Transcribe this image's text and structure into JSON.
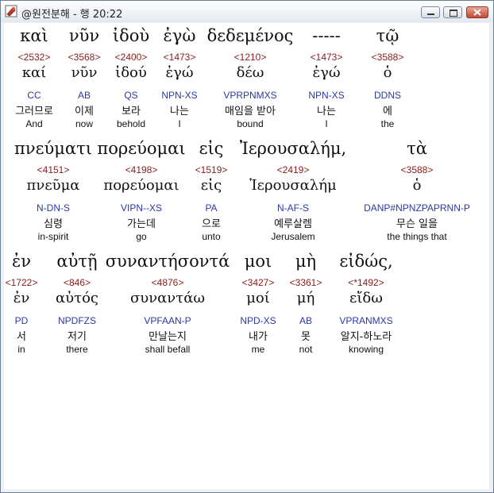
{
  "window": {
    "title": "@원전분해 - 행 20:22",
    "icon": "bible-icon",
    "buttons": [
      "minimize",
      "maximize",
      "close"
    ]
  },
  "colors": {
    "strongs": "#8b1a1a",
    "parsing": "#2a3aa0",
    "text": "#111111",
    "highlight_bg": "#ffffff"
  },
  "lines": [
    {
      "words": [
        {
          "greek": "καὶ",
          "strongs": "<2532>",
          "lemma": "καί",
          "parse": "CC",
          "korean": "그러므로",
          "english": "And"
        },
        {
          "greek": "νῦν",
          "strongs": "<3568>",
          "lemma": "νῦν",
          "parse": "AB",
          "korean": "이제",
          "english": "now"
        },
        {
          "greek": "ἰδοὺ",
          "strongs": "<2400>",
          "lemma": "ἰδού",
          "parse": "QS",
          "korean": "보라",
          "english": "behold"
        },
        {
          "greek": "ἐγὼ",
          "strongs": "<1473>",
          "lemma": "ἐγώ",
          "parse": "NPN-XS",
          "korean": "나는",
          "english": "I"
        },
        {
          "greek": "δεδεμένος",
          "strongs": "<1210>",
          "lemma": "δέω",
          "parse": "VPRPNMXS",
          "korean": "매임을 받아",
          "english": "bound"
        },
        {
          "greek": "-----",
          "strongs": "<1473>",
          "lemma": "ἐγώ",
          "parse": "NPN-XS",
          "korean": "나는",
          "english": "I"
        },
        {
          "greek": "τῷ",
          "strongs": "<3588>",
          "lemma": "ὁ",
          "parse": "DDNS",
          "korean": "에",
          "english": "the"
        }
      ]
    },
    {
      "words": [
        {
          "greek": "πνεύματι",
          "strongs": "<4151>",
          "lemma": "πνεῦμα",
          "parse": "N-DN-S",
          "korean": "심령",
          "english": "in-spirit"
        },
        {
          "greek": "πορεύομαι",
          "strongs": "<4198>",
          "lemma": "πορεύομαι",
          "parse": "VIPN--XS",
          "korean": "가는데",
          "english": "go"
        },
        {
          "greek": "εἰς",
          "strongs": "<1519>",
          "lemma": "εἰς",
          "parse": "PA",
          "korean": "으로",
          "english": "unto"
        },
        {
          "greek": "Ἰερουσαλήμ,",
          "strongs": "<2419>",
          "lemma": "Ἰερουσαλήμ",
          "parse": "N-AF-S",
          "korean": "예루살렘",
          "english": "Jerusalem"
        },
        {
          "greek": "τὰ",
          "strongs": "<3588>",
          "lemma": "ὁ",
          "parse": "DANP#NPNZPAPRNN-P",
          "korean": "무슨 일을",
          "english": "the things that"
        }
      ]
    },
    {
      "words": [
        {
          "greek": "ἐν",
          "strongs": "<1722>",
          "lemma": "ἐν",
          "parse": "PD",
          "korean": "서",
          "english": "in"
        },
        {
          "greek": "αὐτῇ",
          "strongs": "<846>",
          "lemma": "αὐτός",
          "parse": "NPDFZS",
          "korean": "저기",
          "english": "there"
        },
        {
          "greek": "συναντήσοντά",
          "strongs": "<4876>",
          "lemma": "συναντάω",
          "parse": "VPFAAN-P",
          "korean": "만날는지",
          "english": "shall befall"
        },
        {
          "greek": "μοι",
          "strongs": "<3427>",
          "lemma": "μοί",
          "parse": "NPD-XS",
          "korean": "내가",
          "english": "me"
        },
        {
          "greek": "μὴ",
          "strongs": "<3361>",
          "lemma": "μή",
          "parse": "AB",
          "korean": "못",
          "english": "not"
        },
        {
          "greek": "εἰδώς,",
          "strongs": "<*1492>",
          "lemma": "εἴδω",
          "parse": "VPRANMXS",
          "korean": "알지-하노라",
          "english": "knowing"
        }
      ]
    }
  ]
}
